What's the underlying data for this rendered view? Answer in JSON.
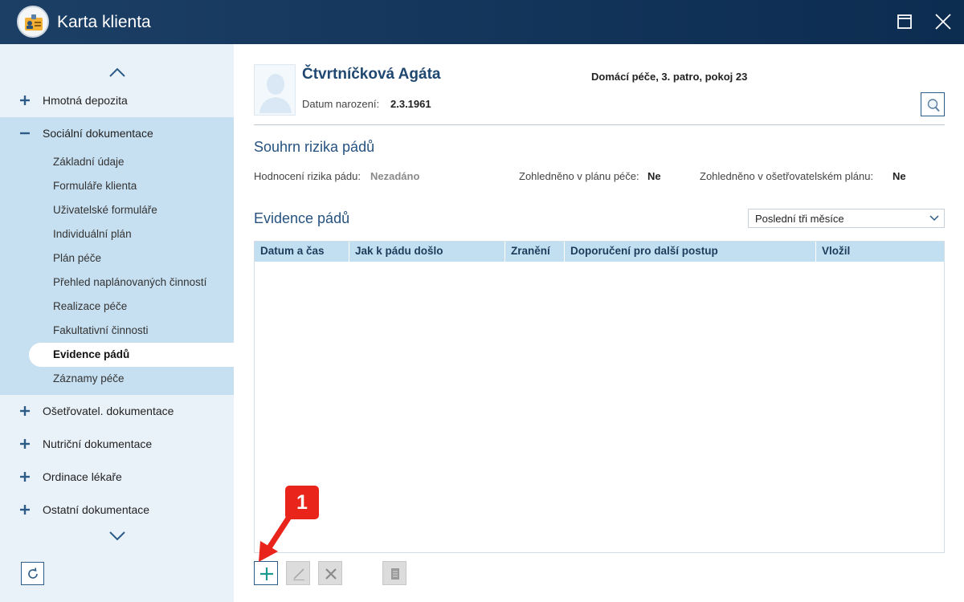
{
  "window": {
    "title": "Karta klienta"
  },
  "sidebar": {
    "groups_top": [
      {
        "label": "Hmotná depozita",
        "sign": "plus"
      }
    ],
    "expanded_group": {
      "label": "Sociální dokumentace",
      "sign": "minus"
    },
    "sub_items": [
      {
        "label": "Základní údaje"
      },
      {
        "label": "Formuláře klienta"
      },
      {
        "label": "Uživatelské formuláře"
      },
      {
        "label": "Individuální plán"
      },
      {
        "label": "Plán péče"
      },
      {
        "label": "Přehled naplánovaných činností"
      },
      {
        "label": "Realizace péče"
      },
      {
        "label": "Fakultativní činnosti"
      },
      {
        "label": "Evidence pádů",
        "active": true
      },
      {
        "label": "Záznamy péče"
      }
    ],
    "groups_bottom": [
      {
        "label": "Ošetřovatel. dokumentace",
        "sign": "plus"
      },
      {
        "label": "Nutriční dokumentace",
        "sign": "plus"
      },
      {
        "label": "Ordinace lékaře",
        "sign": "plus"
      },
      {
        "label": "Ostatní dokumentace",
        "sign": "plus"
      }
    ]
  },
  "client": {
    "name": "Čtvrtníčková Agáta",
    "dob_label": "Datum narození:",
    "dob_value": "2.3.1961",
    "location": "Domácí péče, 3. patro, pokoj 23"
  },
  "risk_summary": {
    "title": "Souhrn rizika pádů",
    "assessment_label": "Hodnocení rizika pádu:",
    "assessment_value": "Nezadáno",
    "care_plan_label": "Zohledněno v plánu péče:",
    "care_plan_value": "Ne",
    "nursing_plan_label": "Zohledněno v ošetřovatelském plánu:",
    "nursing_plan_value": "Ne"
  },
  "falls": {
    "title": "Evidence pádů",
    "period_selected": "Poslední tři měsíce",
    "columns": [
      "Datum a čas",
      "Jak k pádu došlo",
      "Zranění",
      "Doporučení pro další postup",
      "Vložil"
    ],
    "rows": []
  },
  "annotation": {
    "number": "1"
  },
  "colors": {
    "titlebar": "#0c2c50",
    "sidebar_bg": "#eaf2f9",
    "sidebar_expanded_bg": "#c7e0f1",
    "grid_header": "#c2dff2",
    "accent": "#26527f",
    "callout": "#e8241b",
    "add_icon": "#1a9a8c"
  },
  "icons": {
    "app": "client-card-icon",
    "maximize": "maximize-icon",
    "close": "close-icon",
    "search": "magnifier-icon",
    "refresh": "refresh-icon",
    "add": "plus-icon",
    "edit": "pencil-icon",
    "delete": "x-icon",
    "report": "document-icon"
  }
}
